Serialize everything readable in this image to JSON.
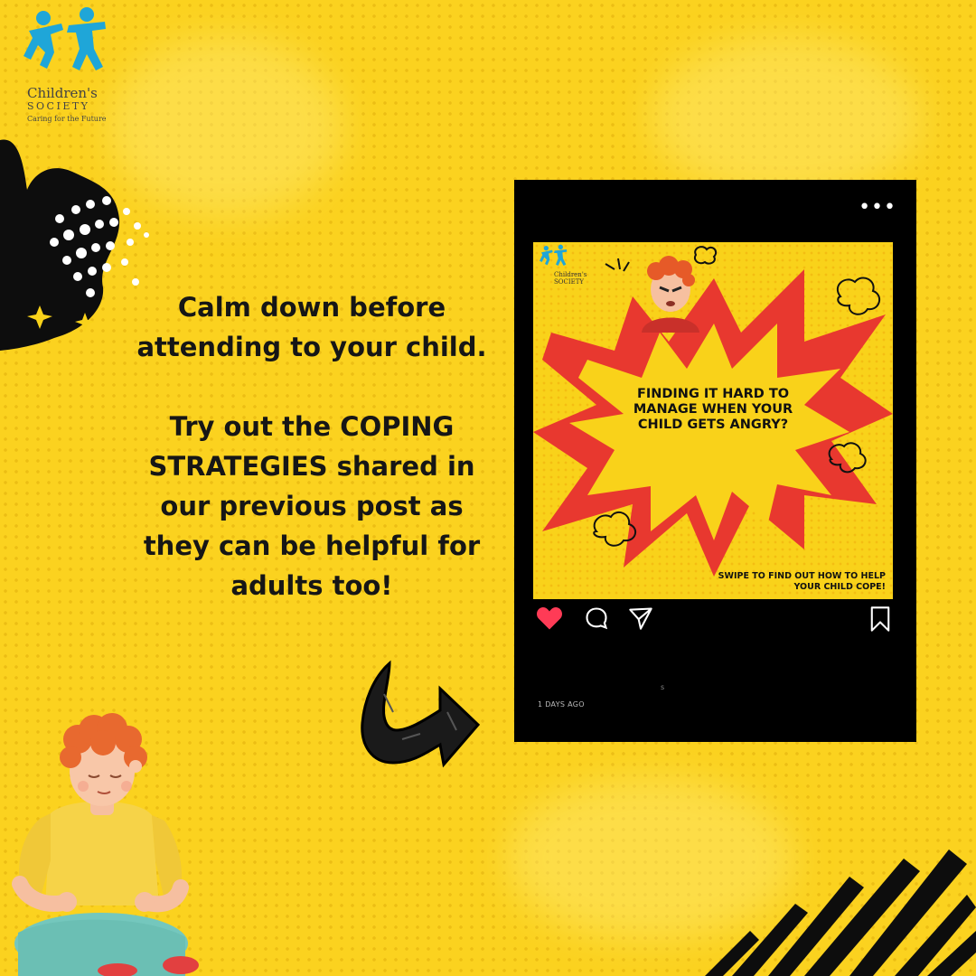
{
  "logo": {
    "name": "Children's",
    "sub": "SOCIETY",
    "tagline": "Caring for the Future"
  },
  "message": {
    "line1": "Calm down before attending to your child.",
    "line2": "Try out the COPING STRATEGIES shared in our previous post as they can be helpful for adults too!"
  },
  "post": {
    "more_icon": "more-horizontal-icon",
    "image": {
      "logo_name": "Children's",
      "logo_sub": "SOCIETY",
      "headline": "FINDING IT HARD TO MANAGE WHEN YOUR CHILD GETS ANGRY?",
      "swipe_text": "SWIPE TO FIND OUT HOW TO HELP YOUR CHILD COPE!"
    },
    "actions": {
      "like": "heart-icon",
      "comment": "comment-icon",
      "share": "send-icon",
      "save": "bookmark-icon"
    },
    "caption": "s",
    "timestamp": "1 DAYS AGO"
  },
  "colors": {
    "background": "#fbd21f",
    "brand_blue": "#1fa6d8",
    "burst_red": "#e8382f",
    "heart": "#ff3b56",
    "card": "#000000"
  }
}
